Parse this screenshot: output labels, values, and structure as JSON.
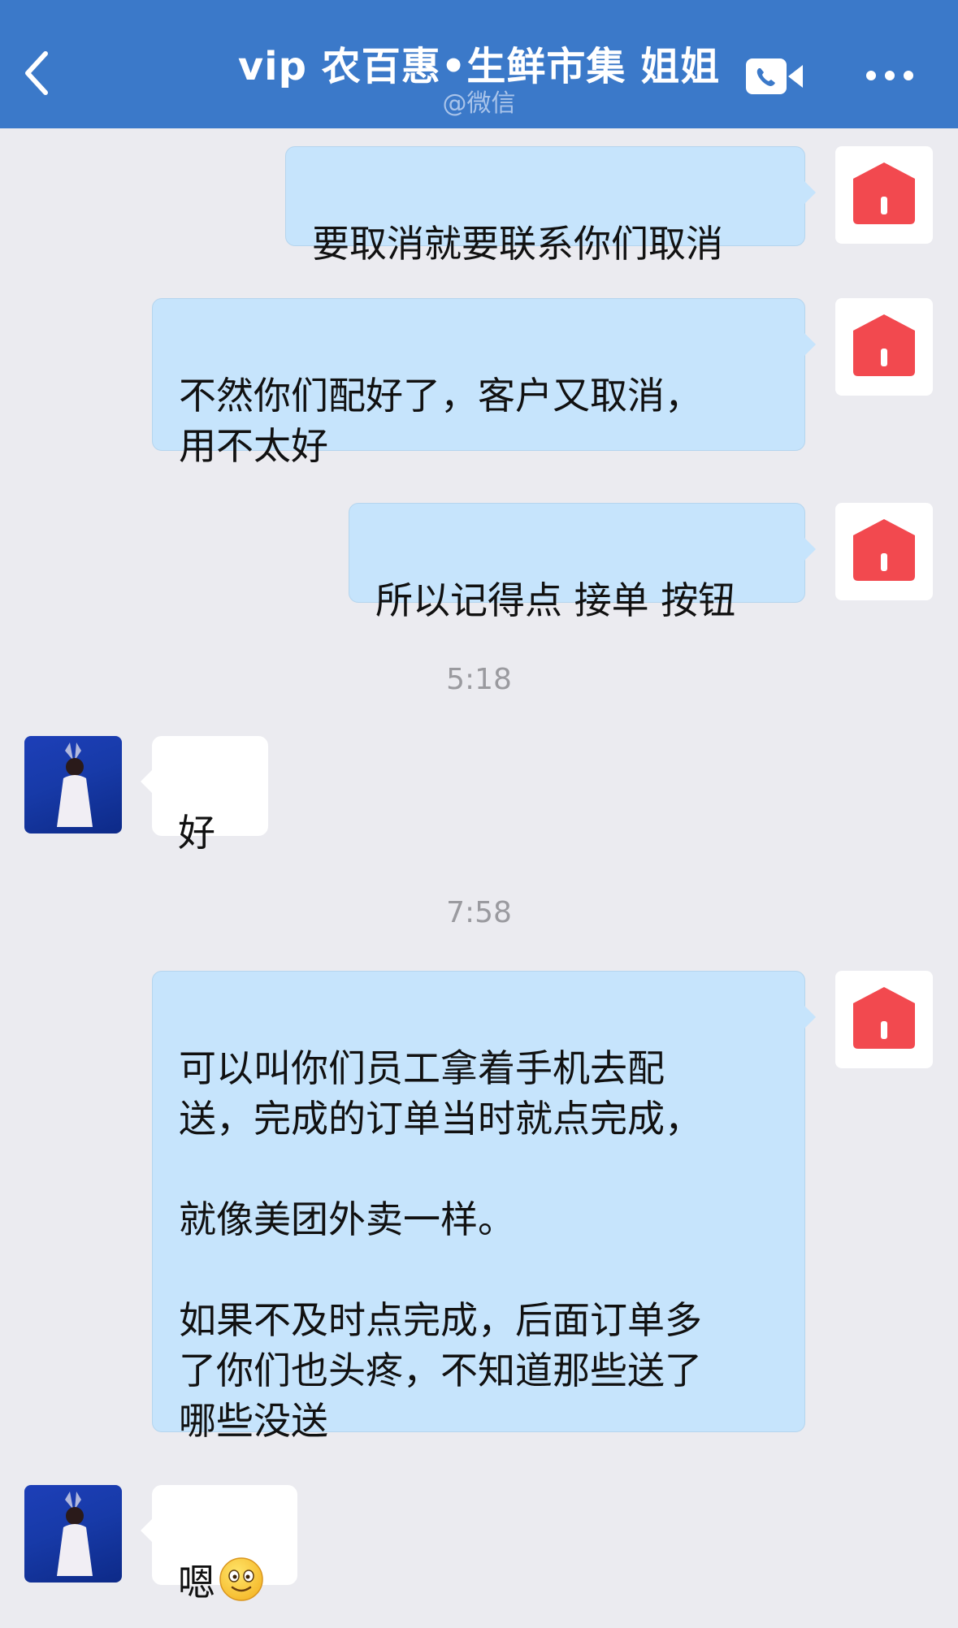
{
  "header": {
    "title": "vip 农百惠•生鲜市集  姐姐",
    "subtitle": "@微信",
    "back_icon": "chevron-left-icon",
    "video_icon": "video-call-icon",
    "more_icon": "more-dots-icon",
    "background_color": "#3b79c9"
  },
  "messages": [
    {
      "sender": "self",
      "text": "要取消就要联系你们取消"
    },
    {
      "sender": "self",
      "text": "不然你们配好了，客户又取消，\n用不太好"
    },
    {
      "sender": "self",
      "text": "所以记得点 接单 按钮"
    },
    {
      "type": "time",
      "text": "5:18"
    },
    {
      "sender": "other",
      "text": "好"
    },
    {
      "type": "time",
      "text": "7:58"
    },
    {
      "sender": "self",
      "text": "可以叫你们员工拿着手机去配\n送，完成的订单当时就点完成，\n\n就像美团外卖一样。\n\n如果不及时点完成，后面订单多\n了你们也头疼，不知道那些送了\n哪些没送"
    },
    {
      "sender": "other",
      "text": "嗯",
      "emoji": "smiley-emoji"
    }
  ],
  "colors": {
    "outgoing_bubble": "#c6e4fc",
    "incoming_bubble": "#ffffff",
    "background": "#ebebf0",
    "store_avatar": "#f2494f"
  }
}
